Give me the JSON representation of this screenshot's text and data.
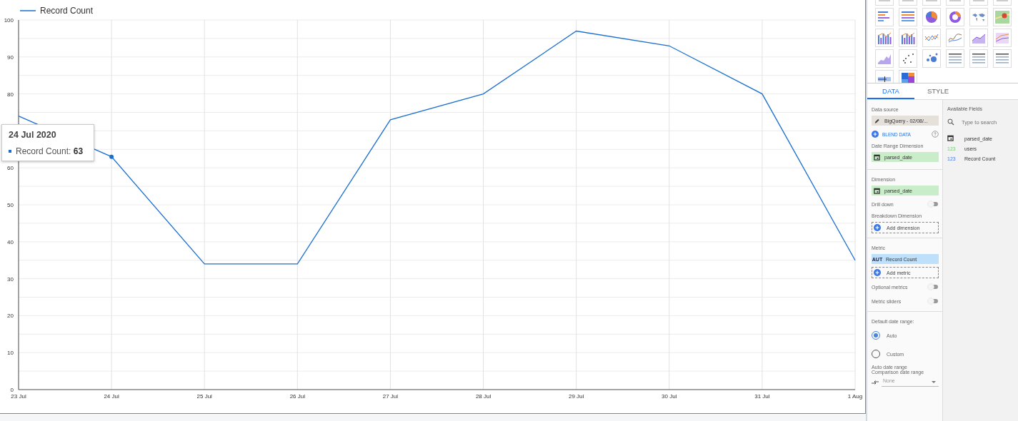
{
  "chart": {
    "chart_data": {
      "type": "line",
      "categories": [
        "23 Jul",
        "24 Jul",
        "25 Jul",
        "26 Jul",
        "27 Jul",
        "28 Jul",
        "29 Jul",
        "30 Jul",
        "31 Jul",
        "1 Aug"
      ],
      "series": [
        {
          "name": "Record Count",
          "color": "#1a6fd1",
          "values": [
            74,
            63,
            34,
            34,
            73,
            80,
            97,
            93,
            80,
            35
          ]
        }
      ],
      "ylim": [
        0,
        100
      ],
      "yticks": [
        0,
        10,
        20,
        30,
        40,
        50,
        60,
        80,
        90,
        100
      ],
      "grid": true
    },
    "points": [
      {
        "selected": false
      },
      {
        "selected": true
      },
      {
        "selected": false
      },
      {
        "selected": false
      },
      {
        "selected": false
      },
      {
        "selected": false
      },
      {
        "selected": false
      },
      {
        "selected": false
      },
      {
        "selected": false
      },
      {
        "selected": false
      }
    ],
    "tooltip": {
      "title": "24 Jul 2020",
      "text": "Record Count: **63**"
    }
  },
  "panel": {
    "tabs": [
      {
        "label": "DATA",
        "selected": true
      },
      {
        "label": "STYLE",
        "selected": false
      }
    ],
    "setup": {
      "data_source_label": "Data source",
      "data_source": "BigQuery - 02/08/...",
      "blend_data": "BLEND DATA",
      "date_range_label": "Date Range Dimension",
      "date_range_field": "parsed_date",
      "dimension_label": "Dimension",
      "dimension_field": "parsed_date",
      "toggles_dim": [
        {
          "label": "Drill down",
          "on": false
        }
      ],
      "breakdown_label": "Breakdown Dimension",
      "add_dimension": "Add dimension",
      "metric_label": "Metric",
      "metric_agg": "AUT",
      "metric_field": "Record Count",
      "add_metric": "Add metric",
      "toggles_metric": [
        {
          "label": "Optional metrics",
          "on": false
        },
        {
          "label": "Metric sliders",
          "on": false
        }
      ],
      "date_range_title": "Default date range:",
      "date_options": [
        {
          "label": "Auto",
          "selected": true
        },
        {
          "label": "Custom",
          "selected": false
        }
      ],
      "auto_date_range": "Auto date range",
      "comparison_label": "Comparison date range",
      "comparison_value": "None"
    },
    "fields": {
      "title": "Available Fields",
      "search_placeholder": "Type to search",
      "items": [
        {
          "kind": "date",
          "name": "parsed_date"
        },
        {
          "kind": "dimension",
          "type_label": "123",
          "name": "users"
        },
        {
          "kind": "metric",
          "type_label": "123",
          "name": "Record Count"
        }
      ]
    }
  }
}
